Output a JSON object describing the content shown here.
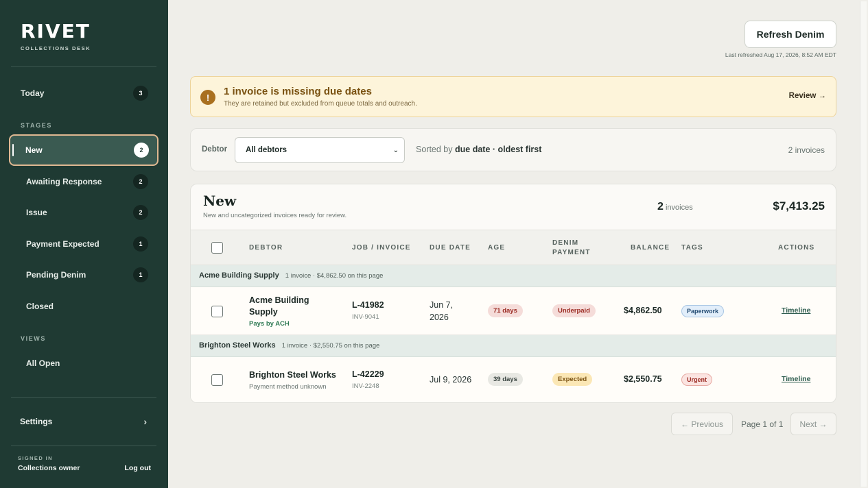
{
  "brand": {
    "name": "RIVET",
    "subtitle": "COLLECTIONS DESK"
  },
  "sidebar": {
    "today": {
      "label": "Today",
      "count": "3"
    },
    "stages_label": "STAGES",
    "stages": [
      {
        "label": "New",
        "count": "2"
      },
      {
        "label": "Awaiting Response",
        "count": "2"
      },
      {
        "label": "Issue",
        "count": "2"
      },
      {
        "label": "Payment Expected",
        "count": "1"
      },
      {
        "label": "Pending Denim",
        "count": "1"
      },
      {
        "label": "Closed",
        "count": ""
      }
    ],
    "views_label": "VIEWS",
    "views": [
      {
        "label": "All Open"
      }
    ],
    "settings_label": "Settings",
    "signed_in_label": "SIGNED IN",
    "user": "Collections owner",
    "logout": "Log out"
  },
  "header": {
    "refresh_label": "Refresh Denim",
    "last_refreshed": "Last refreshed Aug 17, 2026, 8:52 AM EDT"
  },
  "alert": {
    "icon": "!",
    "title": "1 invoice is missing due dates",
    "subtitle": "They are retained but excluded from queue totals and outreach.",
    "action": "Review →"
  },
  "filter": {
    "debtor_label": "Debtor",
    "debtor_value": "All debtors",
    "sorted_prefix": "Sorted by",
    "sorted_value": "due date · oldest first",
    "count": "2 invoices"
  },
  "stage_card": {
    "title": "New",
    "subtitle": "New and uncategorized invoices ready for review.",
    "count_number": "2",
    "count_label": "invoices",
    "total": "$7,413.25",
    "columns": {
      "debtor": "DEBTOR",
      "job": "JOB / INVOICE",
      "due": "DUE DATE",
      "age": "AGE",
      "denim_1": "DENIM",
      "denim_2": "PAYMENT",
      "balance": "BALANCE",
      "tags": "TAGS",
      "actions": "ACTIONS"
    },
    "groups": [
      {
        "name": "Acme Building Supply",
        "meta": "1 invoice · $4,862.50 on this page",
        "row": {
          "debtor_line1": "Acme Building",
          "debtor_line2": "Supply",
          "note": "Pays by ACH",
          "job": "L-41982",
          "invoice": "INV-9041",
          "due_line1": "Jun 7,",
          "due_line2": "2026",
          "age": "71 days",
          "payment": "Underpaid",
          "balance": "$4,862.50",
          "tag": "Paperwork",
          "action": "Timeline"
        }
      },
      {
        "name": "Brighton Steel Works",
        "meta": "1 invoice · $2,550.75 on this page",
        "row": {
          "debtor_line1": "Brighton Steel Works",
          "note": "Payment method unknown",
          "job": "L-42229",
          "invoice": "INV-2248",
          "due_line1": "Jul 9, 2026",
          "age": "39 days",
          "payment": "Expected",
          "balance": "$2,550.75",
          "tag": "Urgent",
          "action": "Timeline"
        }
      }
    ]
  },
  "pagination": {
    "prev": "← Previous",
    "page": "Page 1 of 1",
    "next": "Next →"
  }
}
